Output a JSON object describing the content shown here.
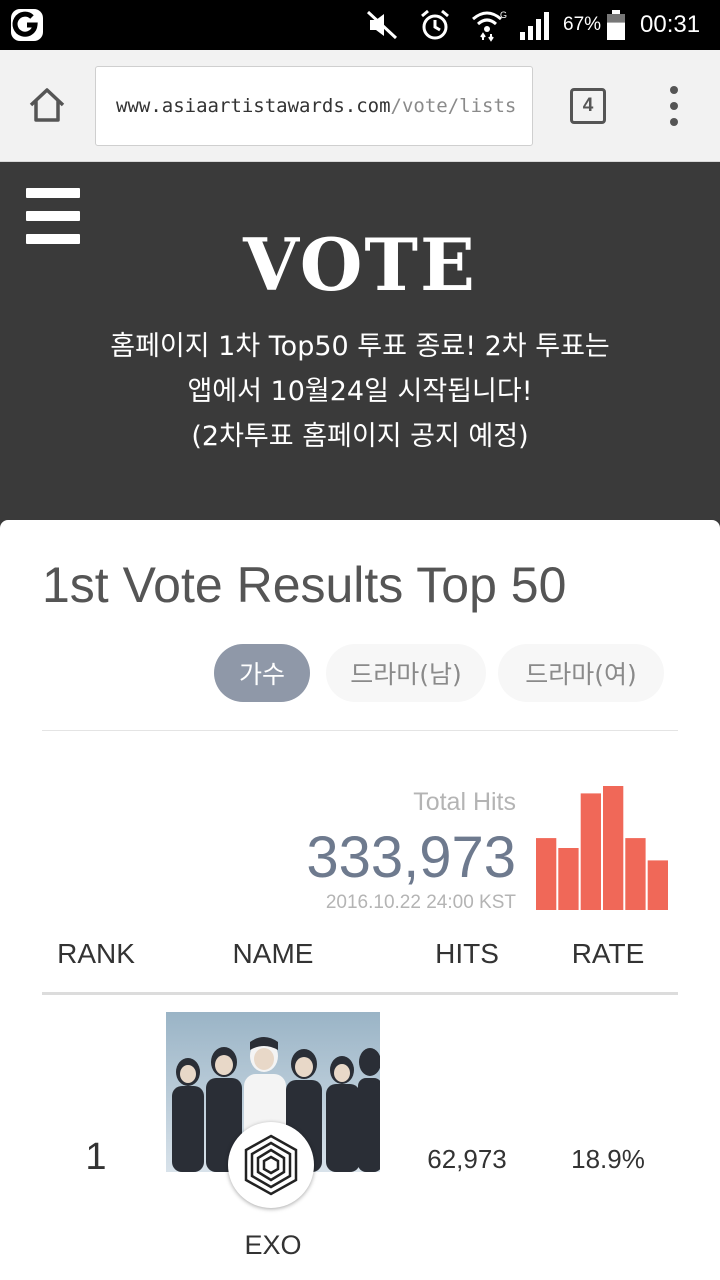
{
  "status_bar": {
    "battery_percent": "67%",
    "battery_level": 0.67,
    "clock": "00:31",
    "network_badge": "G"
  },
  "browser": {
    "url_domain": "www.asiaartistawards.com",
    "url_path": "/vote/lists",
    "tab_count": "4"
  },
  "header": {
    "logo_text": "VOTE",
    "notice_lines": [
      "홈페이지 1차 Top50 투표 종료! 2차 투표는",
      "앱에서 10월24일 시작됩니다!",
      "(2차투표 홈페이지 공지 예정)"
    ]
  },
  "results": {
    "title": "1st Vote Results Top 50",
    "filters": [
      {
        "label": "가수",
        "active": true
      },
      {
        "label": "드라마(남)",
        "active": false
      },
      {
        "label": "드라마(여)",
        "active": false
      }
    ],
    "total_hits_label": "Total Hits",
    "total_hits_value": "333,973",
    "total_hits_date": "2016.10.22 24:00 KST",
    "columns": {
      "rank": "RANK",
      "name": "NAME",
      "hits": "HITS",
      "rate": "RATE"
    },
    "rows": [
      {
        "rank": "1",
        "name": "EXO",
        "hits": "62,973",
        "rate": "18.9%"
      }
    ]
  },
  "mini_chart": {
    "type": "bar",
    "values": [
      0.58,
      0.5,
      0.94,
      1.0,
      0.58,
      0.4
    ],
    "color": "#f06858"
  },
  "colors": {
    "header_bg": "#3a3a3a",
    "accent_filter": "#8f98a8",
    "hits_value": "#6e7a8e",
    "chart_bar": "#f06858"
  }
}
